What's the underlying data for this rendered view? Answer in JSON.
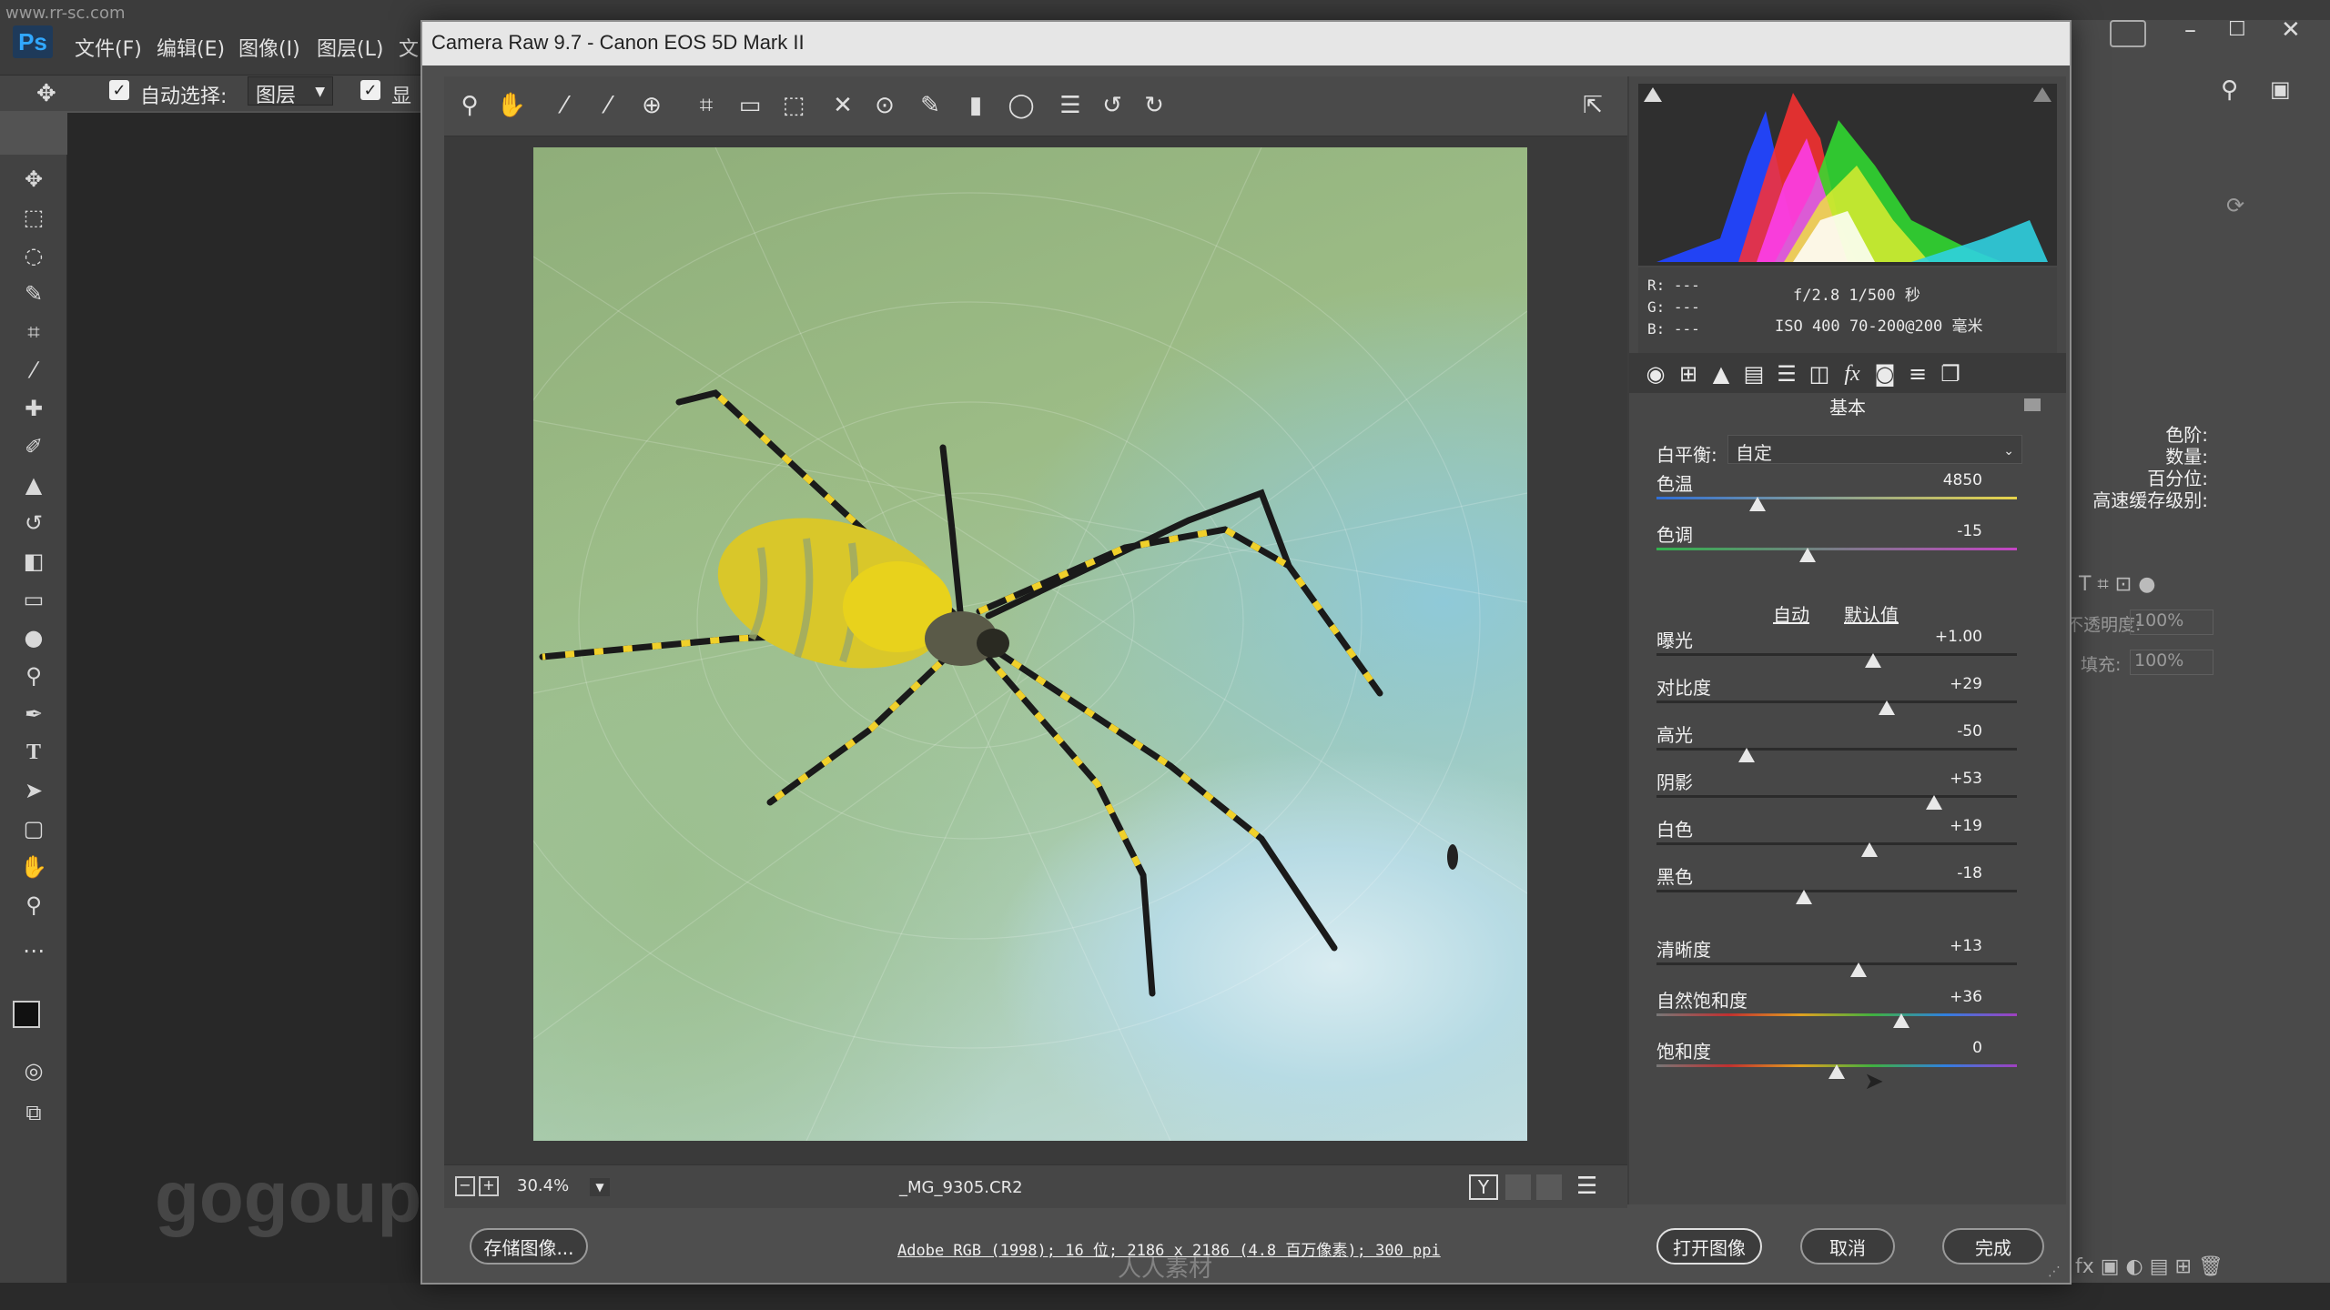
{
  "site_watermark": "www.rr-sc.com",
  "photoshop": {
    "logo": "Ps",
    "menu": [
      "文件(F)",
      "编辑(E)",
      "图像(I)",
      "图层(L)",
      "文"
    ],
    "options": {
      "auto_select_label": "自动选择:",
      "auto_select_value": "图层",
      "show_label": "显"
    },
    "right_panel": {
      "labels": [
        "色阶:",
        "数量:",
        "百分位:",
        "高速缓存级别:"
      ],
      "opacity_label": "不透明度:",
      "opacity_value": "100%",
      "fill_label": "填充:",
      "fill_value": "100%"
    }
  },
  "camera_raw": {
    "title": "Camera Raw 9.7 -  Canon EOS 5D Mark II",
    "readout": {
      "r": "R:  ---",
      "g": "G:  ---",
      "b": "B:  ---",
      "exposure_line": "f/2.8   1/500 秒",
      "iso_line": "ISO 400   70-200@200 毫米"
    },
    "panel_title": "基本",
    "white_balance": {
      "label": "白平衡:",
      "value": "自定"
    },
    "auto_link": "自动",
    "default_link": "默认值",
    "sliders": [
      {
        "label": "色温",
        "value": "4850",
        "pos": 0.28
      },
      {
        "label": "色调",
        "value": "-15",
        "pos": 0.42
      },
      {
        "label": "曝光",
        "value": "+1.00",
        "pos": 0.6
      },
      {
        "label": "对比度",
        "value": "+29",
        "pos": 0.64
      },
      {
        "label": "高光",
        "value": "-50",
        "pos": 0.25
      },
      {
        "label": "阴影",
        "value": "+53",
        "pos": 0.77
      },
      {
        "label": "白色",
        "value": "+19",
        "pos": 0.59
      },
      {
        "label": "黑色",
        "value": "-18",
        "pos": 0.41
      },
      {
        "label": "清晰度",
        "value": "+13",
        "pos": 0.56
      },
      {
        "label": "自然饱和度",
        "value": "+36",
        "pos": 0.68
      },
      {
        "label": "饱和度",
        "value": "0",
        "pos": 0.5
      }
    ],
    "zoom": "30.4%",
    "filename": "_MG_9305.CR2",
    "save_button": "存储图像...",
    "workflow_link": "Adobe RGB (1998); 16 位; 2186 x 2186 (4.8 百万像素); 300 ppi",
    "open_button": "打开图像",
    "cancel_button": "取消",
    "done_button": "完成",
    "preview_mode": "Y"
  },
  "watermarks": {
    "gogoup": "gogoup.com",
    "footer": "人人素材"
  },
  "colors": {
    "accent_ps": "#31a8ff",
    "dialog_bg": "#4e4e4e"
  }
}
